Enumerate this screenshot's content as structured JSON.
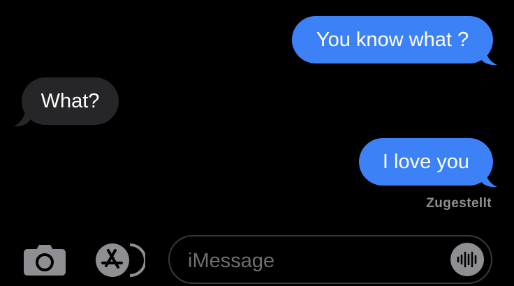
{
  "conversation": {
    "messages": [
      {
        "direction": "sent",
        "text": "You know what ?"
      },
      {
        "direction": "received",
        "text": "What?"
      },
      {
        "direction": "sent",
        "text": "I love you"
      }
    ],
    "delivery_status": "Zugestellt"
  },
  "composer": {
    "placeholder": "iMessage",
    "camera_icon": "camera-icon",
    "apps_icon": "app-store-icon",
    "audio_icon": "audio-waveform-icon"
  },
  "colors": {
    "background": "#000000",
    "sent_bubble": "#3c82f6",
    "received_bubble": "#262629",
    "bubble_text": "#ffffff",
    "status_text": "#8e8e93",
    "placeholder_text": "#6e6e73",
    "icon_gray": "#8e8e93"
  }
}
